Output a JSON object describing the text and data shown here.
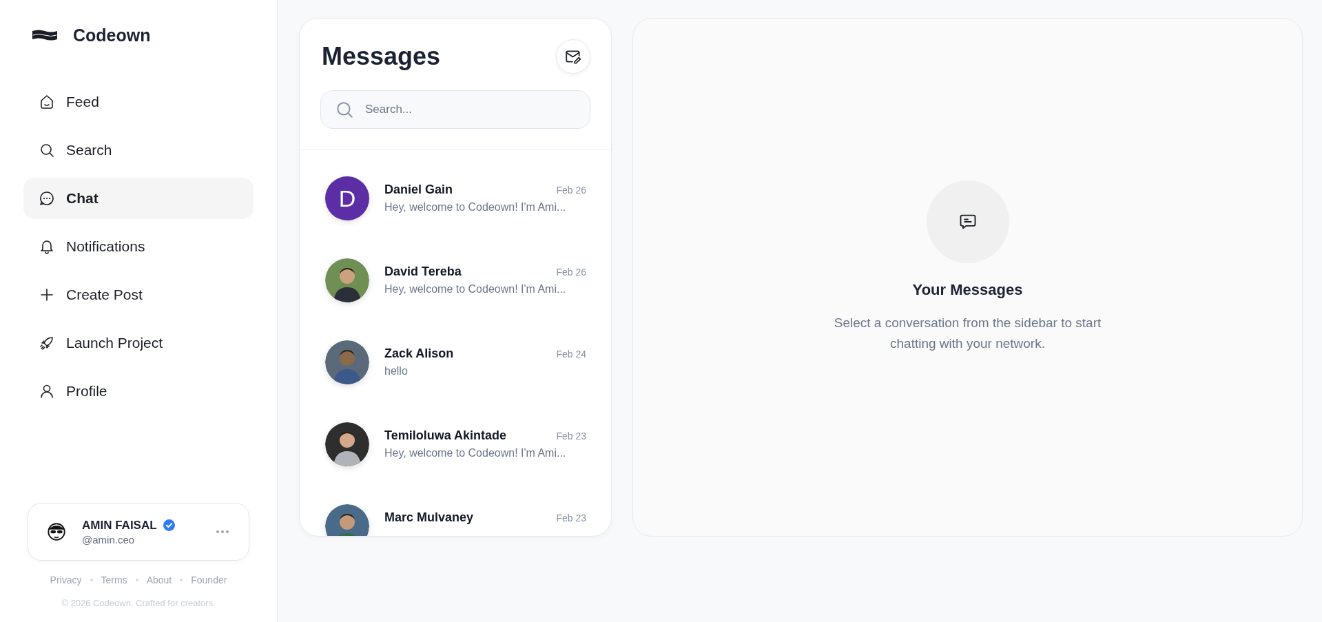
{
  "brand": {
    "name": "Codeown"
  },
  "nav": [
    {
      "label": "Feed",
      "selected": false
    },
    {
      "label": "Search",
      "selected": false
    },
    {
      "label": "Chat",
      "selected": true
    },
    {
      "label": "Notifications",
      "selected": false
    },
    {
      "label": "Create Post",
      "selected": false
    },
    {
      "label": "Launch Project",
      "selected": false
    },
    {
      "label": "Profile",
      "selected": false
    }
  ],
  "user": {
    "name": "AMIN FAISAL",
    "handle": "@amin.ceo",
    "verified": true
  },
  "footer_links": [
    "Privacy",
    "Terms",
    "About",
    "Founder"
  ],
  "copyright": "© 2026 Codeown. Crafted for creators.",
  "messages": {
    "title": "Messages",
    "search": {
      "placeholder": "Search..."
    },
    "conversations": [
      {
        "name": "Daniel Gain",
        "date": "Feb 26",
        "preview": "Hey, welcome to Codeown! I'm Ami...",
        "avatar": {
          "kind": "letter",
          "letter": "D",
          "color": "#5b2ea6"
        }
      },
      {
        "name": "David Tereba",
        "date": "Feb 26",
        "preview": "Hey, welcome to Codeown! I'm Ami..."
      },
      {
        "name": "Zack Alison",
        "date": "Feb 24",
        "preview": "hello"
      },
      {
        "name": "Temiloluwa Akintade",
        "date": "Feb 23",
        "preview": "Hey, welcome to Codeown! I'm Ami..."
      },
      {
        "name": "Marc Mulvaney",
        "date": "Feb 23"
      }
    ]
  },
  "empty_state": {
    "title": "Your Messages",
    "text": "Select a conversation from the sidebar to start chatting with your network."
  }
}
